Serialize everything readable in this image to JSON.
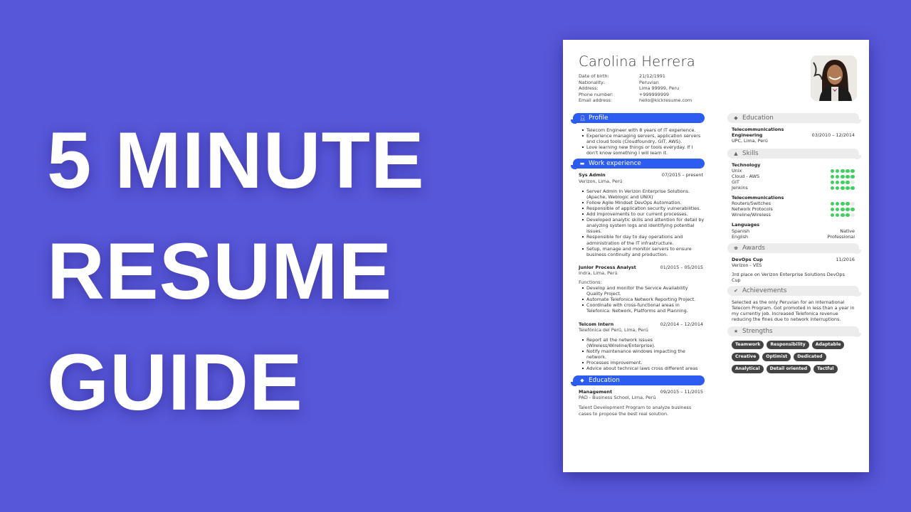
{
  "headline": {
    "lines": [
      "5 MINUTE",
      "RESUME",
      "GUIDE"
    ]
  },
  "colors": {
    "background": "#5757d9",
    "accent_blue": "#2c5df0",
    "skill_green": "#3fcf60",
    "tag_dark": "#444444"
  },
  "resume": {
    "name": "Carolina Herrera",
    "photo_alt": "profile-photo",
    "personal": [
      {
        "label": "Date of birth:",
        "value": "21/12/1991"
      },
      {
        "label": "Nationality:",
        "value": "Peruvian"
      },
      {
        "label": "Address:",
        "value": "Lima 99999, Peru"
      },
      {
        "label": "Phone number:",
        "value": "+999999999"
      },
      {
        "label": "Email address:",
        "value": "hello@kickresume.com"
      }
    ],
    "profile": {
      "title": "Profile",
      "icon": "user-icon",
      "items": [
        "Telecom Engineer with 8 years of  IT experience.",
        "Experience managing servers, application servers and cloud tools (Cloudfoundry, GIT, AWS).",
        "Love learning new things or tools everyday. If I don't know something I will learn it."
      ]
    },
    "work": {
      "title": "Work experience",
      "icon": "briefcase-icon",
      "jobs": [
        {
          "title": "Sys Admin",
          "dates": "07/2015 – present",
          "org": "Verizon, Lima, Perú",
          "intro": "",
          "items": [
            "Server Admin in Verizon Enterprise Solutions. (Apache, Weblogic and UNIX)",
            "Follow Agile Mindset DevOps Automation.",
            "Responsible of application security vulnerabilities.",
            "Add improvements to our current processes.",
            "Developed analytic skills and attention for detail by analyzing system logs and identifying potential issues.",
            "Responsible for day to day operations and administration of the IT infrastructure.",
            "Setup, manage and monitor servers to ensure business continuity and production."
          ]
        },
        {
          "title": "Junior Process Analyst",
          "dates": "01/2015 – 05/2015",
          "org": "Indra, Lima, Perú",
          "intro": "Functions:",
          "items": [
            "Develop and monitor the Service Availability Quality Project.",
            "Automate Telefonica Network Reporting Project.",
            "Coordinate with cross-functional areas in Telefonica: Network, Platforms and Planning."
          ]
        },
        {
          "title": "Telcom Intern",
          "dates": "02/2014 – 12/2014",
          "org": "Telefónica del Perú, Lima, Perú",
          "intro": "",
          "items": [
            "Report all the network issues (Wireless/Wireline/Enterprise).",
            "Notify maintenance windows impacting the network.",
            "Processes improvement.",
            "Advice about technical laws cross different areas"
          ]
        }
      ]
    },
    "education_left": {
      "title": "Education",
      "icon": "graduation-cap-icon",
      "entry": {
        "title": "Management",
        "dates": "09/2015 – 11/2015",
        "org": "PAD - Business School, Lima, Perú",
        "desc": "Talent Development Program to analyze business cases to propose the best real solution."
      }
    },
    "education_right": {
      "title": "Education",
      "icon": "graduation-cap-icon",
      "entry": {
        "title_line1": "Telecommunications",
        "title_line2": "Engineering",
        "dates": "03/2010 – 12/2014",
        "org": "UPC, Lima, Perú"
      }
    },
    "skills": {
      "title": "Skills",
      "icon": "flask-icon",
      "groups": [
        {
          "name": "Technology",
          "items": [
            {
              "label": "Unix",
              "level": 5,
              "max": 5
            },
            {
              "label": "Cloud - AWS",
              "level": 5,
              "max": 5
            },
            {
              "label": "GIT",
              "level": 4,
              "max": 5
            },
            {
              "label": "Jenkins",
              "level": 5,
              "max": 5
            }
          ]
        },
        {
          "name": "Telecommunications",
          "items": [
            {
              "label": "Routers/Switches",
              "level": 4,
              "max": 5
            },
            {
              "label": "Network Protocols",
              "level": 5,
              "max": 5
            },
            {
              "label": "Wireline/Wireless",
              "level": 4,
              "max": 5
            }
          ]
        }
      ],
      "languages_title": "Languages",
      "languages": [
        {
          "label": "Spanish",
          "level": "Native"
        },
        {
          "label": "English",
          "level": "Professional"
        }
      ]
    },
    "awards": {
      "title": "Awards",
      "icon": "trophy-icon",
      "entry": {
        "title": "DevOps Cup",
        "date": "11/2016",
        "org": "Verizon - VES",
        "desc": "3rd place on Verizon Enterprise Solutions DevOps Cup"
      }
    },
    "achievements": {
      "title": "Achievements",
      "icon": "checkmark-icon",
      "text": "Selected as the only Peruvian for an international Telecom Program. Got promoted in less than a year in my currently job. Increased Telefonica revenue reducing the fines due to network interruptions."
    },
    "strengths": {
      "title": "Strengths",
      "icon": "star-icon",
      "tags": [
        "Teamwork",
        "Responsibility",
        "Adaptable",
        "Creative",
        "Optimist",
        "Dedicated",
        "Analytical",
        "Detail oriented",
        "Tactful"
      ]
    }
  }
}
